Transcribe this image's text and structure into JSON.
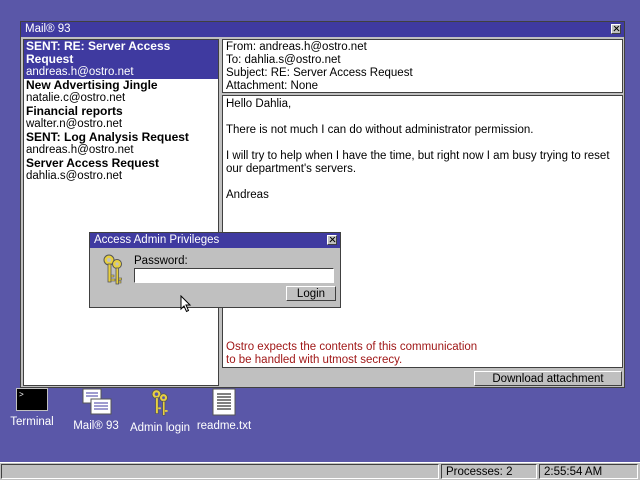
{
  "mail_window": {
    "title": "Mail® 93"
  },
  "messages": [
    {
      "subject": "SENT: RE: Server Access Request",
      "address": "andreas.h@ostro.net"
    },
    {
      "subject": "New Advertising Jingle",
      "address": "natalie.c@ostro.net"
    },
    {
      "subject": "Financial reports",
      "address": "walter.n@ostro.net"
    },
    {
      "subject": "SENT: Log Analysis Request",
      "address": "andreas.h@ostro.net"
    },
    {
      "subject": "Server Access Request",
      "address": "dahlia.s@ostro.net"
    }
  ],
  "header": {
    "from": "From: andreas.h@ostro.net",
    "to": "To: dahlia.s@ostro.net",
    "subject": "Subject: RE: Server Access Request",
    "attachment": "Attachment: None"
  },
  "body": {
    "greeting": "Hello Dahlia,",
    "p1": "There is not much I can do without administrator permission.",
    "p2": "I will try to help when I have the time, but right now I am busy trying to reset our department's servers.",
    "signature": "Andreas",
    "footer_line1": "Ostro expects the contents of this communication",
    "footer_line2": "to be handled with utmost secrecy."
  },
  "download_button": "Download attachment",
  "dialog": {
    "title": "Access Admin Privileges",
    "password_label": "Password:",
    "password_value": "",
    "login_button": "Login"
  },
  "desktop_icons": [
    {
      "label": "Terminal",
      "icon": "terminal-icon"
    },
    {
      "label": "Mail® 93",
      "icon": "mail-icon"
    },
    {
      "label": "Admin login",
      "icon": "keys-icon"
    },
    {
      "label": "readme.txt",
      "icon": "document-icon"
    }
  ],
  "taskbar": {
    "processes": "Processes: 2",
    "clock": "2:55:54 AM"
  },
  "colors": {
    "desktop": "#5a57a8",
    "titlebar": "#3f3aa0",
    "window": "#c0c0c0",
    "footer_text": "#a01818"
  }
}
